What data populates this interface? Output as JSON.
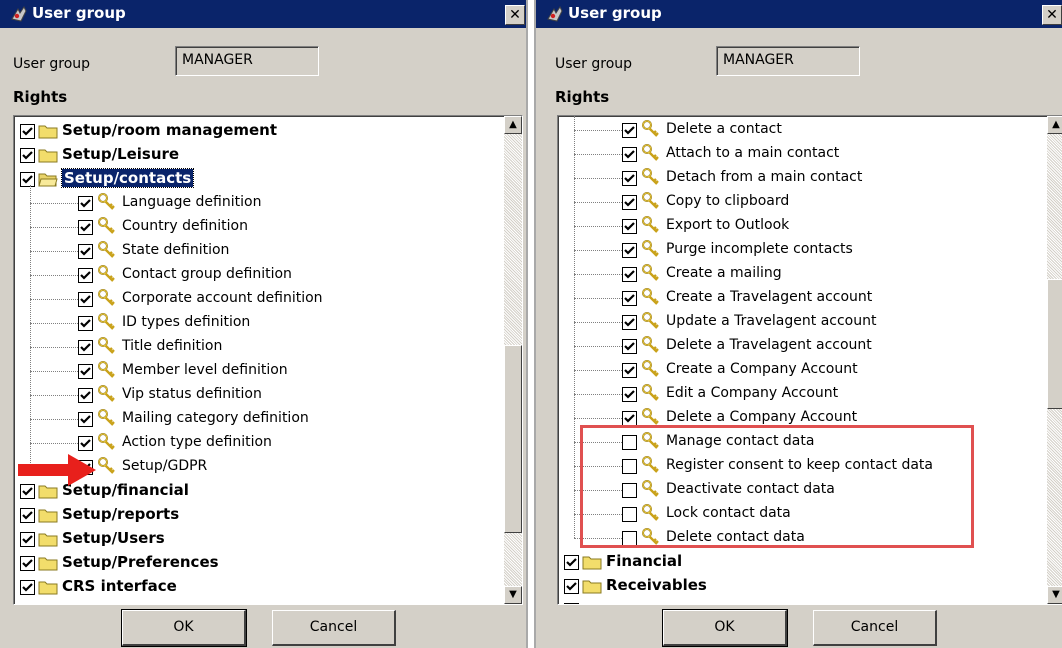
{
  "left_window": {
    "title": "User group",
    "close_glyph": "✕",
    "field_label": "User group",
    "field_value": "MANAGER",
    "rights_label": "Rights",
    "tree": [
      {
        "level": 0,
        "label": "Setup/room management",
        "checked": true,
        "icon": "folder-icon"
      },
      {
        "level": 0,
        "label": "Setup/Leisure",
        "checked": true,
        "icon": "folder-icon"
      },
      {
        "level": 0,
        "label": "Setup/contacts",
        "checked": true,
        "icon": "folder-open-icon",
        "selected": true
      },
      {
        "level": 1,
        "label": "Language definition",
        "checked": true,
        "icon": "key-icon"
      },
      {
        "level": 1,
        "label": "Country definition",
        "checked": true,
        "icon": "key-icon"
      },
      {
        "level": 1,
        "label": "State definition",
        "checked": true,
        "icon": "key-icon"
      },
      {
        "level": 1,
        "label": "Contact group definition",
        "checked": true,
        "icon": "key-icon"
      },
      {
        "level": 1,
        "label": "Corporate account definition",
        "checked": true,
        "icon": "key-icon"
      },
      {
        "level": 1,
        "label": "ID types definition",
        "checked": true,
        "icon": "key-icon"
      },
      {
        "level": 1,
        "label": "Title definition",
        "checked": true,
        "icon": "key-icon"
      },
      {
        "level": 1,
        "label": "Member level definition",
        "checked": true,
        "icon": "key-icon"
      },
      {
        "level": 1,
        "label": "Vip status definition",
        "checked": true,
        "icon": "key-icon"
      },
      {
        "level": 1,
        "label": "Mailing category definition",
        "checked": true,
        "icon": "key-icon"
      },
      {
        "level": 1,
        "label": "Action type definition",
        "checked": true,
        "icon": "key-icon"
      },
      {
        "level": 1,
        "label": "Setup/GDPR",
        "checked": true,
        "icon": "key-icon",
        "last_child": true
      },
      {
        "level": 0,
        "label": "Setup/financial",
        "checked": true,
        "icon": "folder-icon"
      },
      {
        "level": 0,
        "label": "Setup/reports",
        "checked": true,
        "icon": "folder-icon"
      },
      {
        "level": 0,
        "label": "Setup/Users",
        "checked": true,
        "icon": "folder-icon"
      },
      {
        "level": 0,
        "label": "Setup/Preferences",
        "checked": true,
        "icon": "folder-icon"
      },
      {
        "level": 0,
        "label": "CRS interface",
        "checked": true,
        "icon": "folder-icon"
      }
    ],
    "scroll_position": 0.8,
    "ok_label": "OK",
    "cancel_label": "Cancel",
    "annotation_arrow_color": "#e8201c"
  },
  "right_window": {
    "title": "User group",
    "close_glyph": "✕",
    "field_label": "User group",
    "field_value": "MANAGER",
    "rights_label": "Rights",
    "tree": [
      {
        "level": 1,
        "label": "Delete a contact",
        "checked": true,
        "icon": "key-icon"
      },
      {
        "level": 1,
        "label": "Attach to a main contact",
        "checked": true,
        "icon": "key-icon"
      },
      {
        "level": 1,
        "label": "Detach from a main contact",
        "checked": true,
        "icon": "key-icon"
      },
      {
        "level": 1,
        "label": "Copy to clipboard",
        "checked": true,
        "icon": "key-icon"
      },
      {
        "level": 1,
        "label": "Export to Outlook",
        "checked": true,
        "icon": "key-icon"
      },
      {
        "level": 1,
        "label": "Purge incomplete contacts",
        "checked": true,
        "icon": "key-icon"
      },
      {
        "level": 1,
        "label": "Create a mailing",
        "checked": true,
        "icon": "key-icon"
      },
      {
        "level": 1,
        "label": "Create a Travelagent account",
        "checked": true,
        "icon": "key-icon"
      },
      {
        "level": 1,
        "label": "Update a Travelagent account",
        "checked": true,
        "icon": "key-icon"
      },
      {
        "level": 1,
        "label": "Delete a Travelagent account",
        "checked": true,
        "icon": "key-icon"
      },
      {
        "level": 1,
        "label": "Create a Company Account",
        "checked": true,
        "icon": "key-icon"
      },
      {
        "level": 1,
        "label": "Edit a Company Account",
        "checked": true,
        "icon": "key-icon"
      },
      {
        "level": 1,
        "label": "Delete a Company Account",
        "checked": true,
        "icon": "key-icon"
      },
      {
        "level": 1,
        "label": "Manage contact data",
        "checked": false,
        "icon": "key-icon"
      },
      {
        "level": 1,
        "label": "Register consent to keep contact data",
        "checked": false,
        "icon": "key-icon"
      },
      {
        "level": 1,
        "label": "Deactivate contact data",
        "checked": false,
        "icon": "key-icon"
      },
      {
        "level": 1,
        "label": "Lock contact data",
        "checked": false,
        "icon": "key-icon"
      },
      {
        "level": 1,
        "label": "Delete contact data",
        "checked": false,
        "icon": "key-icon",
        "last_child": true
      },
      {
        "level": 0,
        "label": "Financial",
        "checked": true,
        "icon": "folder-icon"
      },
      {
        "level": 0,
        "label": "Receivables",
        "checked": true,
        "icon": "folder-icon"
      },
      {
        "level": 0,
        "label": "",
        "checked": true,
        "icon": "folder-icon"
      }
    ],
    "scroll_position": 0.45,
    "ok_label": "OK",
    "cancel_label": "Cancel",
    "highlight_color": "#e05050"
  }
}
